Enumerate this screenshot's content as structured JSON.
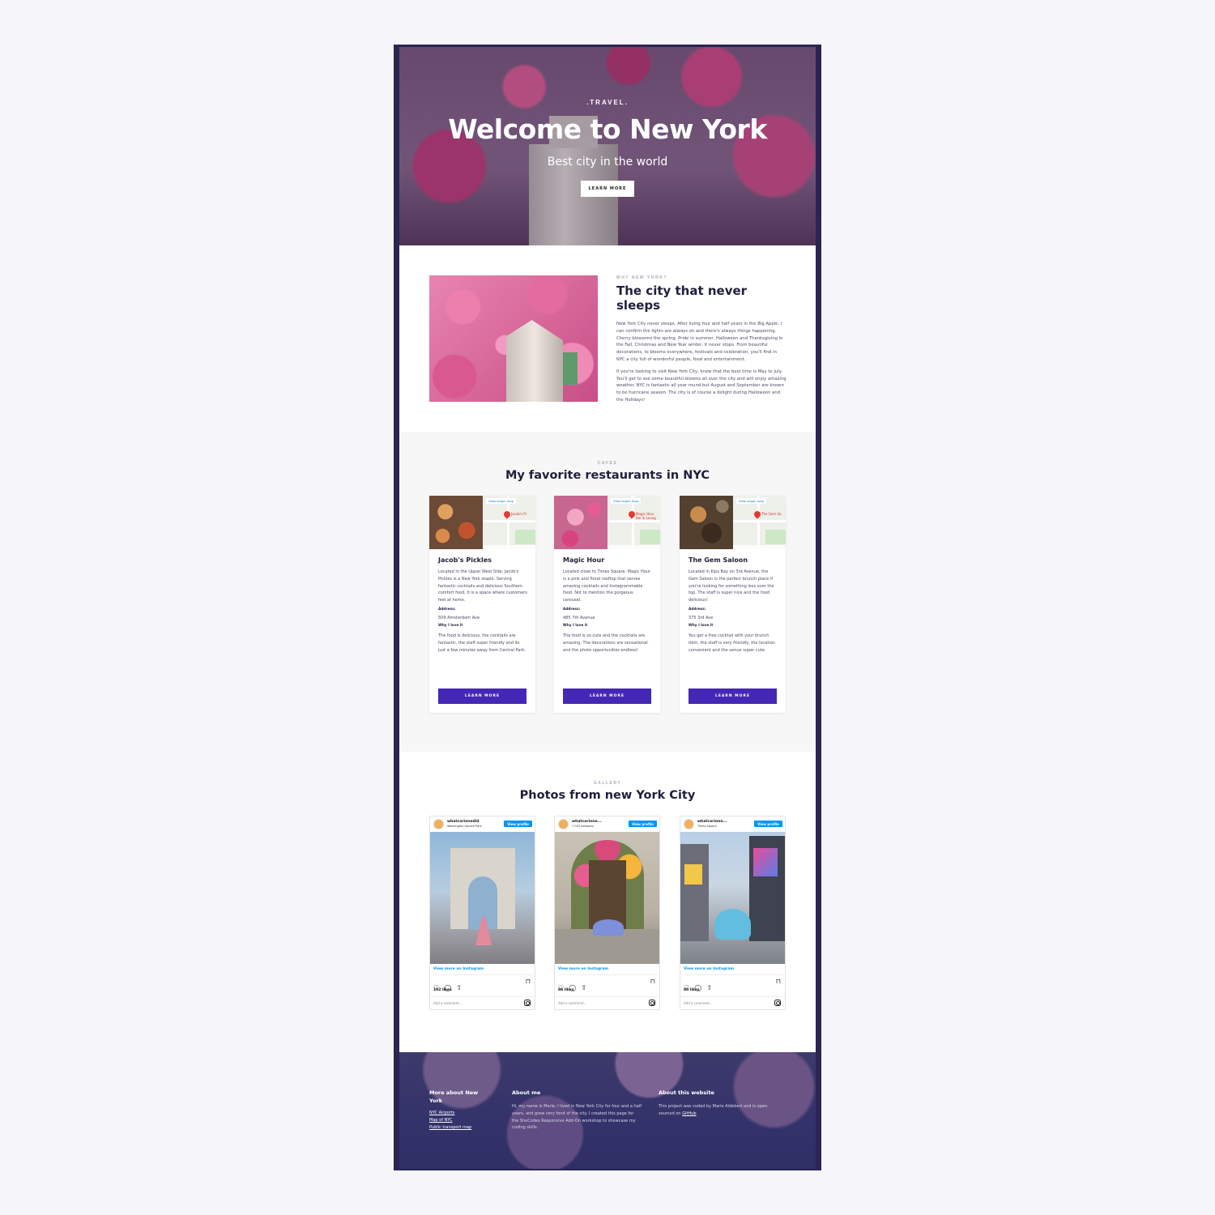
{
  "hero": {
    "eyebrow": ".TRAVEL.",
    "title": "Welcome to New York",
    "subtitle": "Best city in the world",
    "button": "LEARN MORE"
  },
  "about": {
    "eyebrow": "WHY NEW YORK?",
    "title": "The city that never sleeps",
    "paragraphs": [
      "New York City never sleeps. After living four and half years in the Big Apple, I can confirm the lights are always on and there's always things happening. Cherry blossoms the spring, Pride in summer, Halloween and Thanksgiving in the Fall, Christmas and New Year winter, it never stops. From beautiful decorations, to blooms everywhere, festivals and celebration, you'll find in NYC a city full of wonderful people, food and entertainment.",
      "If you're looking to visit New York City, know that the best time is May to July. You'll get to see some beautiful blooms all over the city and will enjoy amazing weather. NYC is fantastic all year round but August and September are known to be hurricane season. The city is of course a delight during Halloween and the Holidays!"
    ]
  },
  "restaurants": {
    "eyebrow": "CAFÉS",
    "title": "My favorite restaurants in NYC",
    "map_link": "View larger map",
    "address_label": "Address:",
    "why_label": "Why I love it",
    "button": "LEARN MORE",
    "items": [
      {
        "name": "Jacob's Pickles",
        "pin": "Jacob's Pi",
        "description": "Located in the Upper West Side, Jacob's Pickles is a New York staple. Serving fantastic cocktails and delicious Southern comfort food, it is a space where customers feel at home.",
        "address": "509 Amsterdam Ave",
        "why": "The food is delicious, the cocktails are fantastic, the staff super friendly and its just a few minutes away from Central Park.",
        "photo_color": "#b5673a"
      },
      {
        "name": "Magic Hour",
        "pin": "Magic Hour Bar & Loung",
        "description": "Located close to Times Square, Magic Hour is a pink and floral rooftop that serves amazing cocktails and Instagrammable food. Not to mention the gorgeous carousel.",
        "address": "485 7th Avenue",
        "why": "The food is so cute and the cocktails are amazing. The decorations are sensational and the photo opportunities endless!",
        "photo_color": "#e87aa5"
      },
      {
        "name": "The Gem Saloon",
        "pin": "The Gem Sa",
        "description": "Located in Kips Bay on 3rd Avenue, the Gem Saloon is the perfect brunch place if you're looking for something less over the top. The staff is super nice and the food delicious!",
        "address": "375 3rd Ave",
        "why": "You get a free cocktail with your brunch item, the staff is very friendly, the location convenient and the venue super cute.",
        "photo_color": "#6a4a33"
      }
    ]
  },
  "gallery": {
    "eyebrow": "GALLERY",
    "title": "Photos from new York City",
    "view_profile": "View profile",
    "view_more": "View more on Instagram",
    "add_comment": "Add a comment...",
    "posts": [
      {
        "user": "whatcorinnedid",
        "subtitle": "Washington Square Park",
        "likes": "102 likes",
        "sky": "#8fb6d9",
        "dress": "#e38a9a"
      },
      {
        "user": "whatcorinne...",
        "subtitle": "7,053 followers",
        "likes": "86 likes",
        "sky": "#c9c3b6",
        "dress": "#7d90d9"
      },
      {
        "user": "whatcorinne...",
        "subtitle": "Times Square",
        "likes": "80 likes",
        "sky": "#b9cfe6",
        "dress": "#62bde0"
      }
    ]
  },
  "footer": {
    "col1_title": "More about New York",
    "links": [
      "NYC Airports",
      "Map of NYC",
      "Public transport map"
    ],
    "col2_title": "About me",
    "col2_text": "Hi, my name is Marie, I lived in New York City for four and a half years, and grew very fond of the city. I created this page for the SheCodes Responsive Add-On workshop to showcase my coding skills.",
    "col3_title": "About this website",
    "col3_text": "This project was coded by Marie Aldebert and is open-sourced on ",
    "col3_link": "GitHub"
  }
}
